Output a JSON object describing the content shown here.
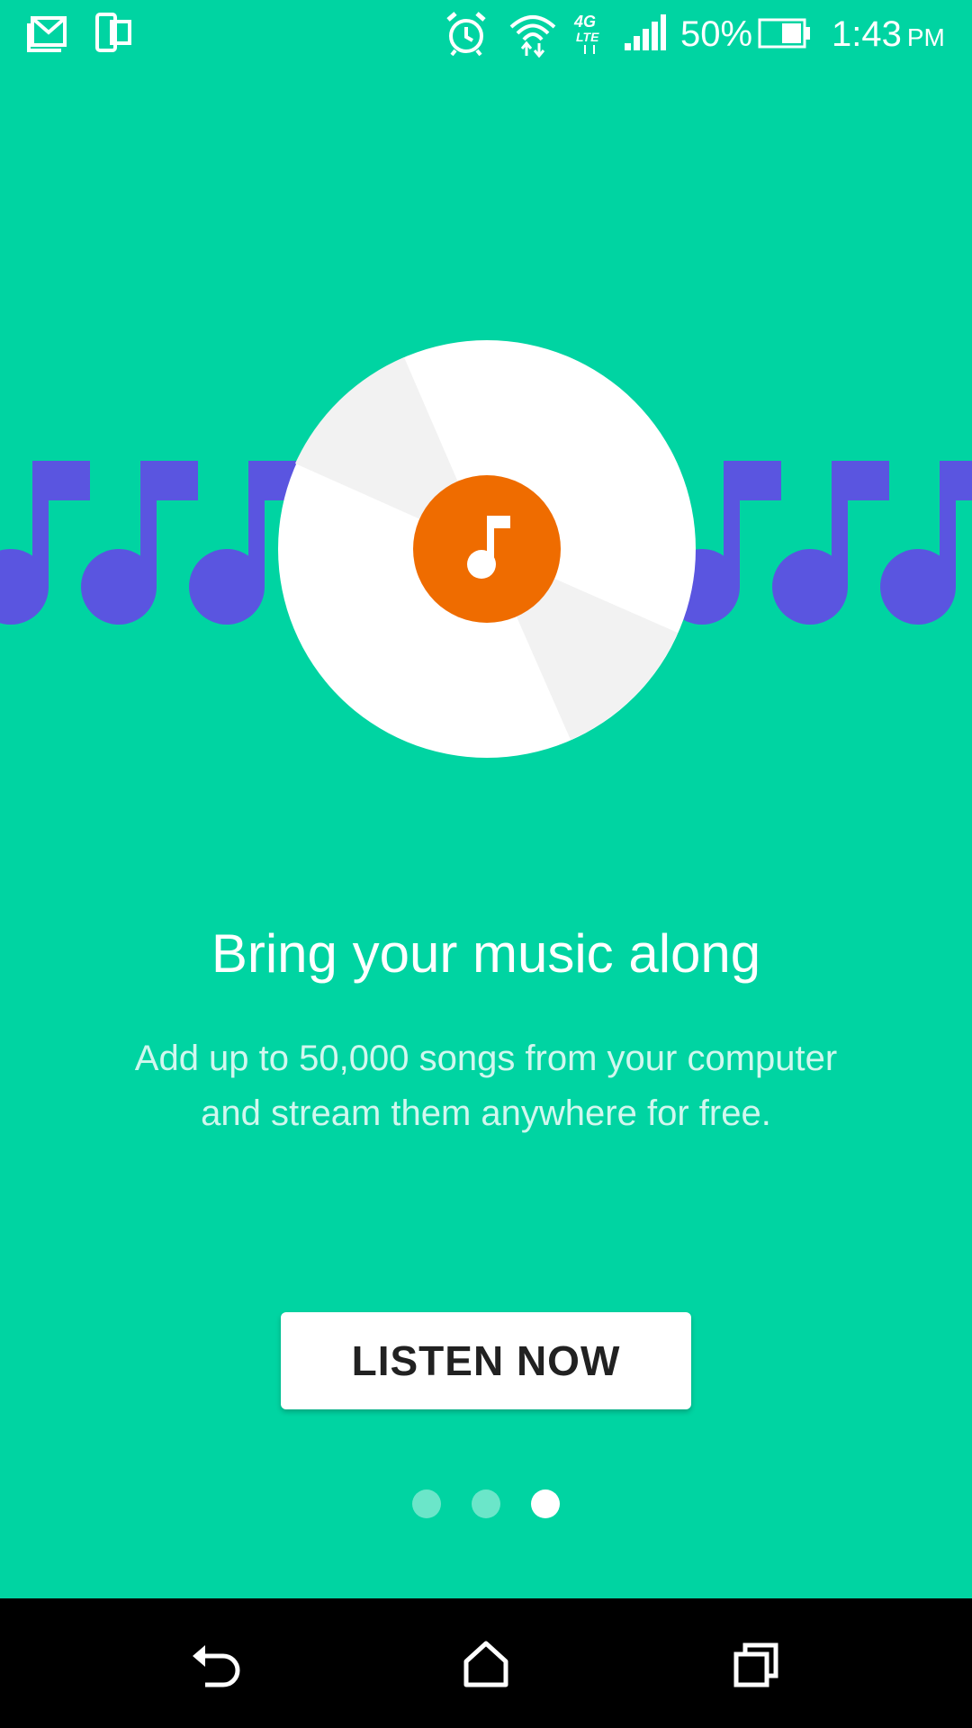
{
  "status_bar": {
    "battery_percent": "50%",
    "battery_level": 0.5,
    "time": "1:43",
    "ampm": "PM",
    "network_type": "4G LTE",
    "icons": [
      "gmail-icon",
      "phone-tablet-icon",
      "alarm-icon",
      "wifi-icon",
      "lte-icon",
      "signal-icon",
      "battery-icon"
    ]
  },
  "onboarding": {
    "title": "Bring your music along",
    "description": "Add up to 50,000 songs from your computer and stream them anywhere for free.",
    "cta_label": "LISTEN NOW",
    "page_count": 3,
    "active_page": 3
  },
  "navigation": {
    "icons": [
      "back-icon",
      "home-icon",
      "recents-icon"
    ]
  },
  "colors": {
    "background": "#00D4A2",
    "note_color": "#5A55E0",
    "disc": "#FFFFFF",
    "disc_shade": "#F2F2F2",
    "disc_center": "#EF6C00",
    "button_text": "#212121",
    "nav_bar": "#000000"
  }
}
